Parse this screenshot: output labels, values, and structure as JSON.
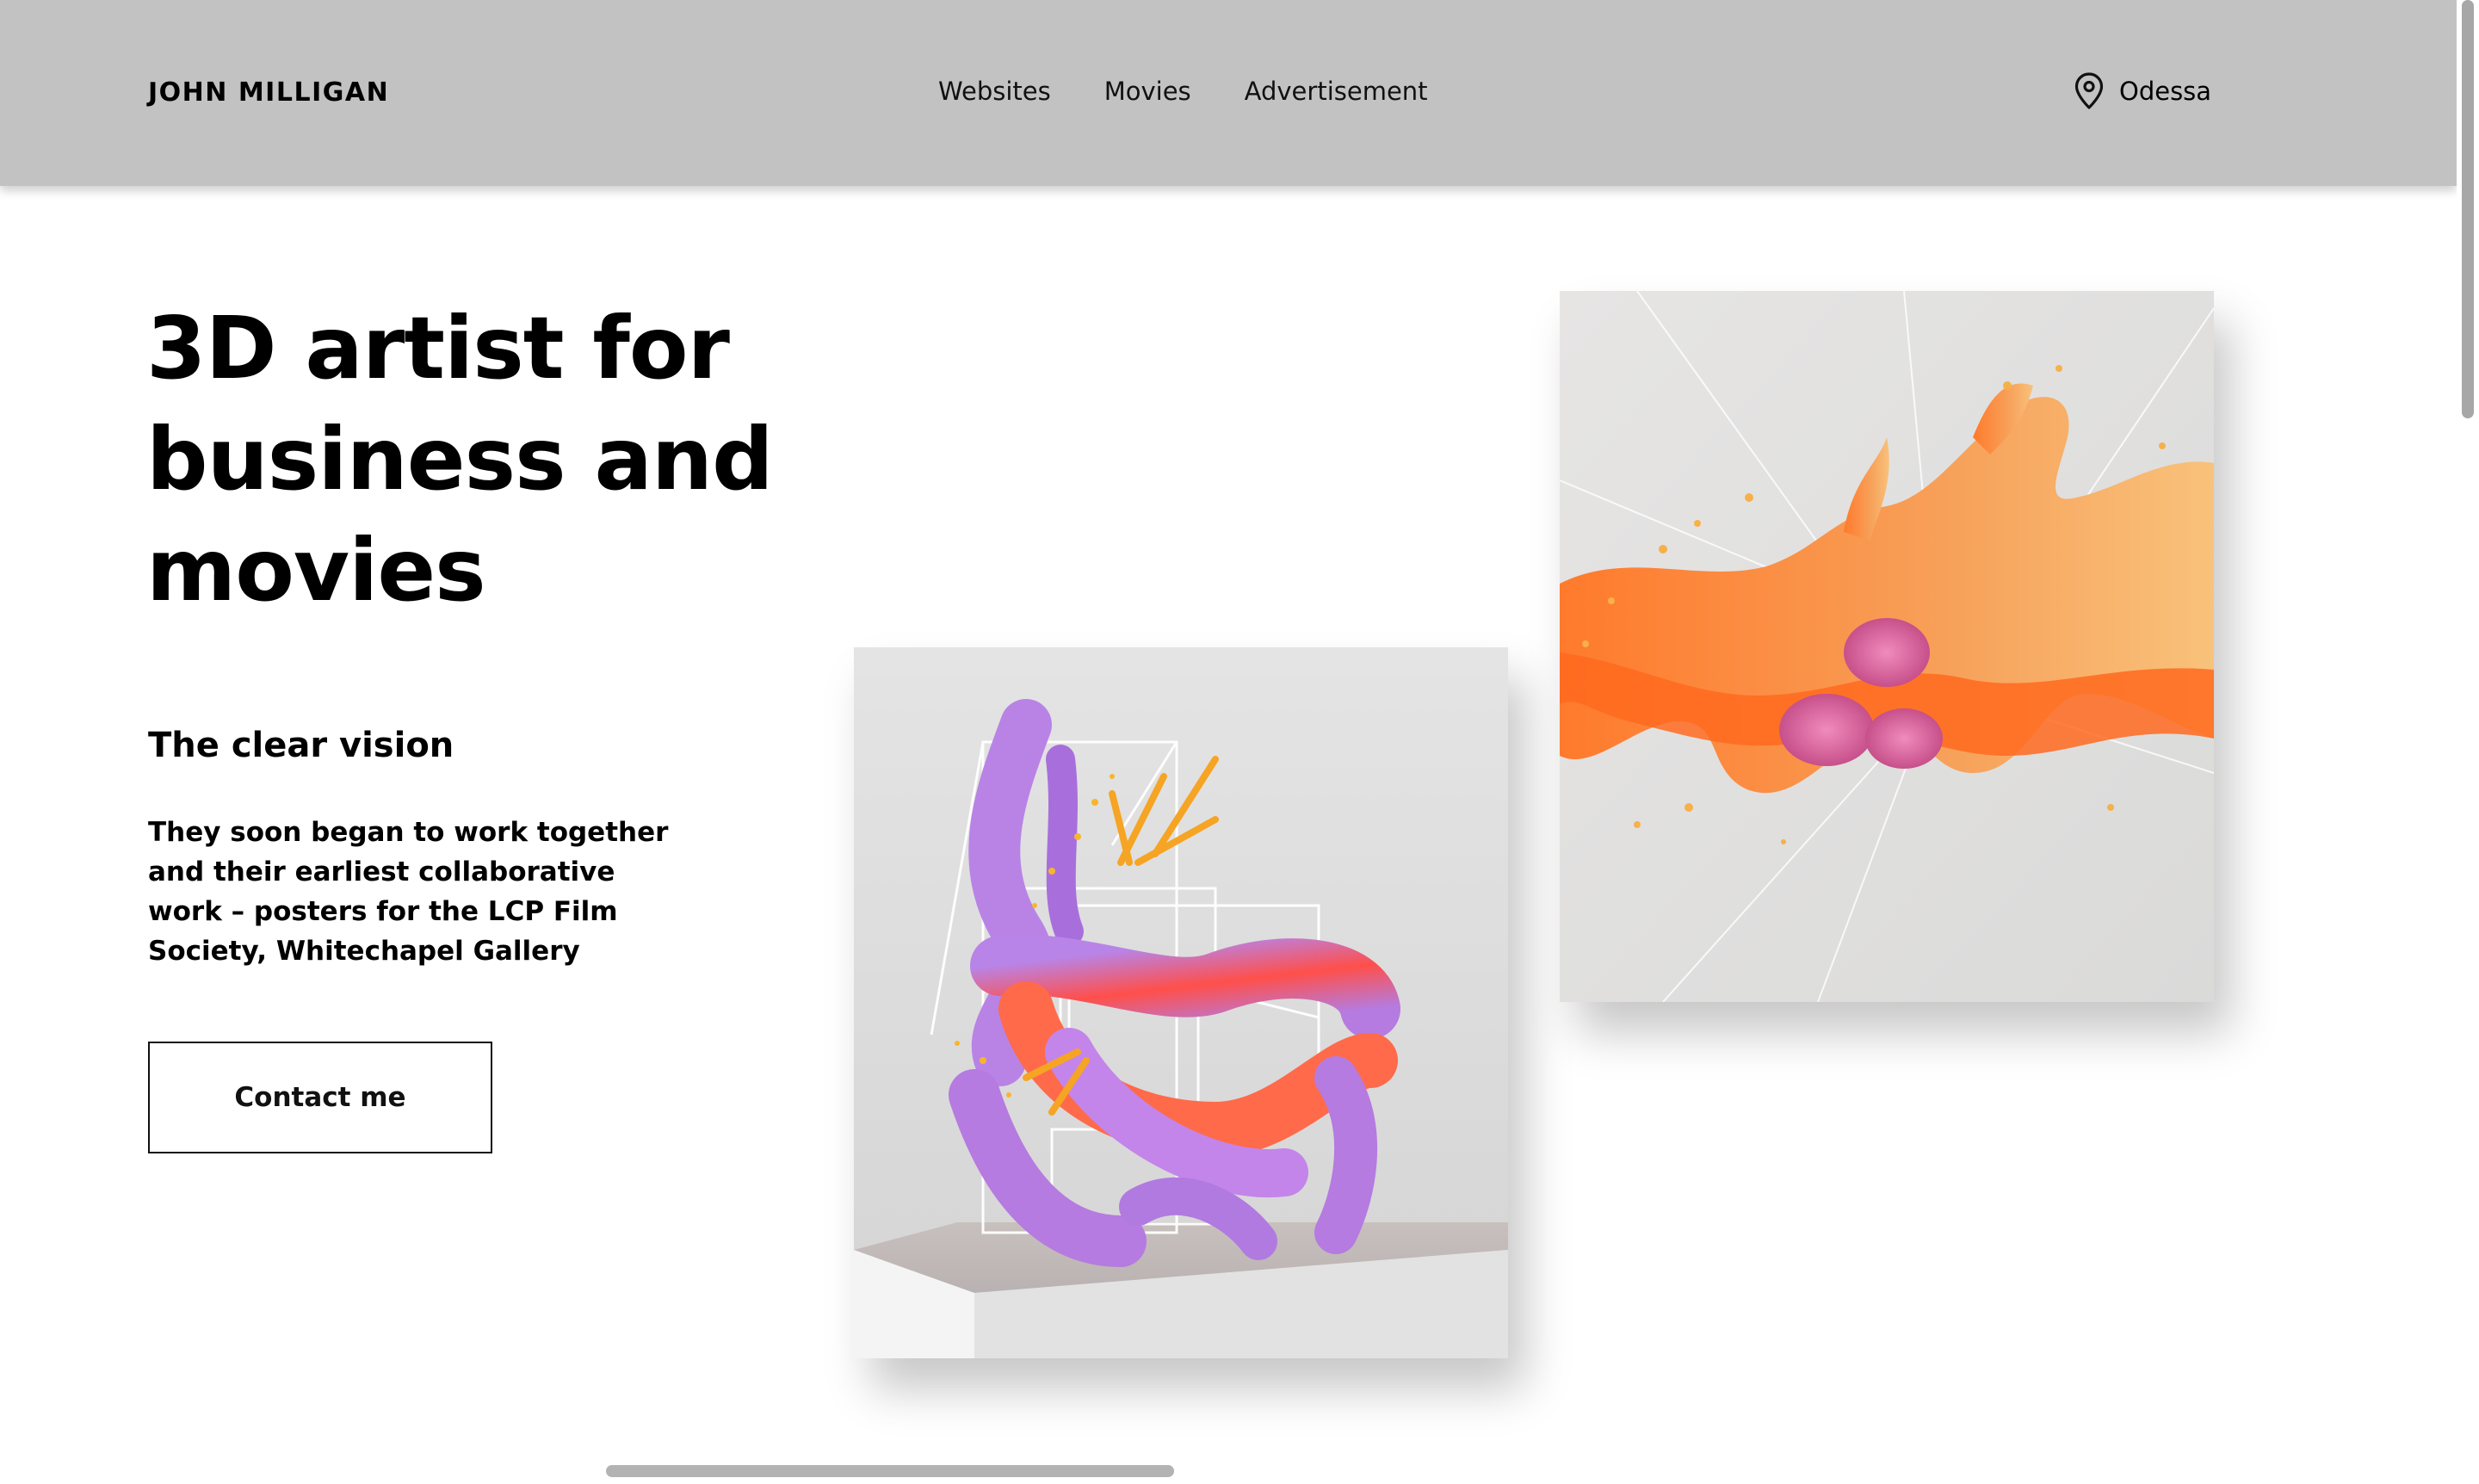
{
  "header": {
    "brand": "JOHN MILLIGAN",
    "nav": [
      {
        "label": "Websites"
      },
      {
        "label": "Movies"
      },
      {
        "label": "Advertisement"
      }
    ],
    "location": {
      "icon": "location-pin-icon",
      "label": "Odessa"
    }
  },
  "hero": {
    "title_lines": [
      "3D artist for",
      "business and",
      "movies"
    ],
    "subtitle": "The clear vision",
    "body_lines": [
      "They soon began to work together",
      "and their earliest collaborative",
      "work – posters for the LCP Film",
      "Society, Whitechapel Gallery"
    ],
    "cta_label": "Contact me"
  },
  "artworks": [
    {
      "name": "purple-coral-sculpture",
      "colors": [
        "#b57be0",
        "#ff5a3c",
        "#f6a423"
      ]
    },
    {
      "name": "orange-coral-sculpture",
      "colors": [
        "#ff7a2c",
        "#f7c27b",
        "#d75a9a"
      ]
    }
  ],
  "colors": {
    "header_bg": "#c2c2c2",
    "text": "#000000",
    "page_bg": "#ffffff"
  }
}
